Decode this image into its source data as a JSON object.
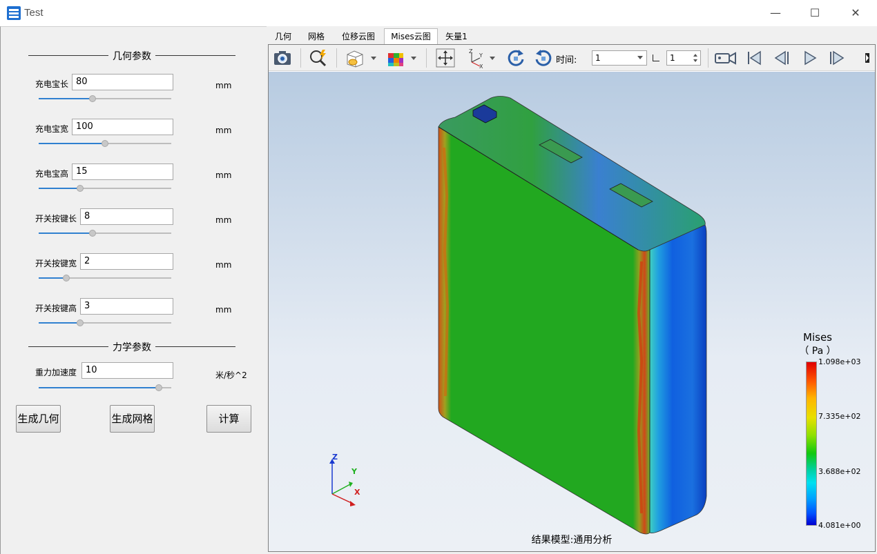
{
  "window": {
    "title": "Test",
    "minimize": "—",
    "maximize": "☐",
    "close": "✕"
  },
  "left": {
    "geom_group": "几何参数",
    "mech_group": "力学参数",
    "params": [
      {
        "label": "充电宝长",
        "value": "80",
        "unit": "mm",
        "level": 0.4
      },
      {
        "label": "充电宝宽",
        "value": "100",
        "unit": "mm",
        "level": 0.5
      },
      {
        "label": "充电宝高",
        "value": "15",
        "unit": "mm",
        "level": 0.3
      },
      {
        "label": "开关按键长",
        "value": "8",
        "unit": "mm",
        "level": 0.4
      },
      {
        "label": "开关按键宽",
        "value": "2",
        "unit": "mm",
        "level": 0.19
      },
      {
        "label": "开关按键高",
        "value": "3",
        "unit": "mm",
        "level": 0.3
      }
    ],
    "gravity": {
      "label": "重力加速度",
      "value": "10",
      "unit": "米/秒^2",
      "level": 0.93
    },
    "buttons": {
      "gen_geom": "生成几何",
      "gen_mesh": "生成网格",
      "compute": "计算"
    }
  },
  "tabs": [
    "几何",
    "网格",
    "位移云图",
    "Mises云图",
    "矢量1"
  ],
  "active_tab": "Mises云图",
  "toolbar": {
    "time_label": "时间:",
    "time_value": "1",
    "step_value": "1"
  },
  "viewer": {
    "legend": {
      "title_line1": "Mises",
      "title_line2": "（ Pa ）",
      "max": "1.098e+03",
      "v2": "7.335e+02",
      "v3": "3.688e+02",
      "min": "4.081e+00"
    },
    "axes": {
      "z": "Z",
      "y": "Y",
      "x": "X"
    },
    "footer": "结果模型:通用分析"
  },
  "colors": {
    "accent": "#2f80d0",
    "mesh_green": "#22a820"
  }
}
